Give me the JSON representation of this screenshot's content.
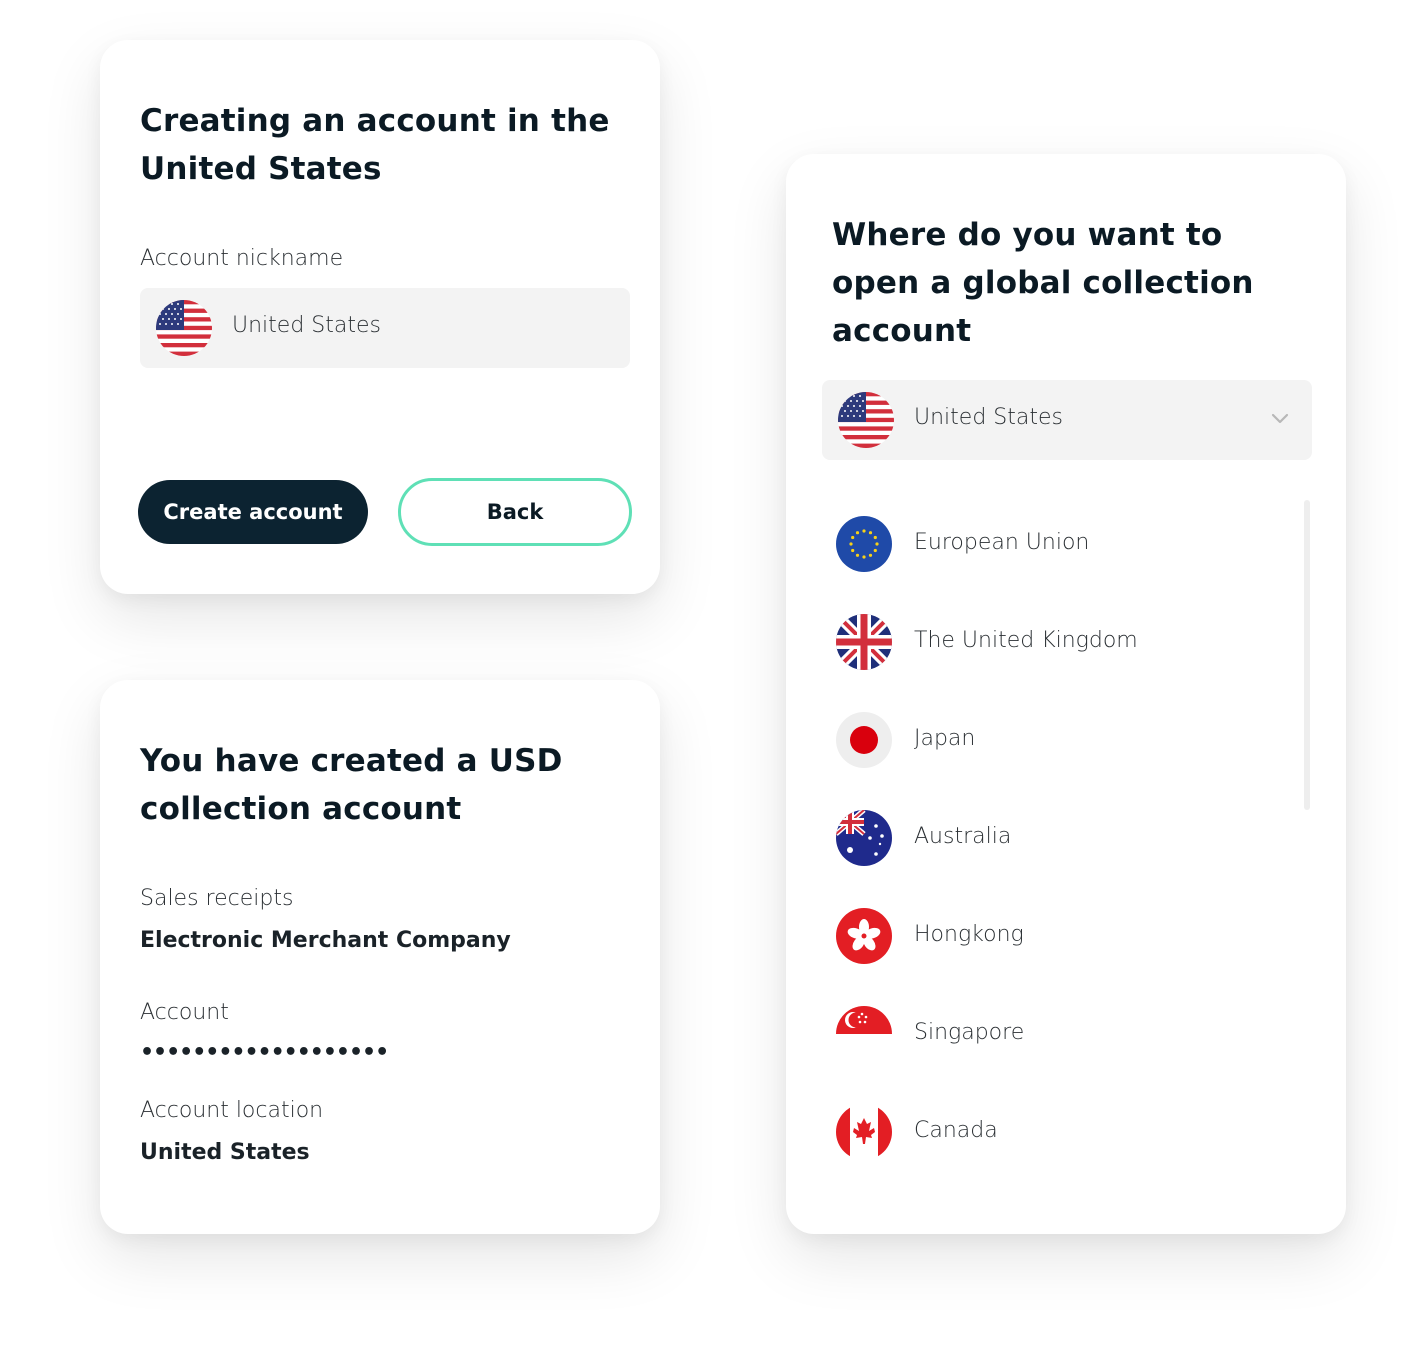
{
  "create_card": {
    "title": "Creating an account in the United States",
    "nickname_label": "Account nickname",
    "nickname_value": "United States",
    "nickname_flag_icon": "us-flag-icon",
    "create_button": "Create account",
    "back_button": "Back"
  },
  "created_card": {
    "title": "You have created a USD collection account",
    "sales_receipts_label": "Sales receipts",
    "sales_receipts_value": "Electronic Merchant Company",
    "account_label": "Account",
    "account_value": "•••••••••••••••••••",
    "location_label": "Account location",
    "location_value": "United States"
  },
  "select_card": {
    "title": "Where do you want to open a global collection account",
    "selected": "United States",
    "selected_flag_icon": "us-flag-icon",
    "dropdown_icon": "chevron-down-icon",
    "countries": [
      {
        "name": "European Union",
        "icon": "eu-flag-icon"
      },
      {
        "name": "The United Kingdom",
        "icon": "uk-flag-icon"
      },
      {
        "name": "Japan",
        "icon": "japan-flag-icon"
      },
      {
        "name": "Australia",
        "icon": "australia-flag-icon"
      },
      {
        "name": "Hongkong",
        "icon": "hongkong-flag-icon"
      },
      {
        "name": "Singapore",
        "icon": "singapore-flag-icon"
      },
      {
        "name": "Canada",
        "icon": "canada-flag-icon"
      }
    ]
  },
  "colors": {
    "primary_button": "#0c2331",
    "outline_accent": "#5fe0b6",
    "field_background": "#f3f3f3"
  }
}
